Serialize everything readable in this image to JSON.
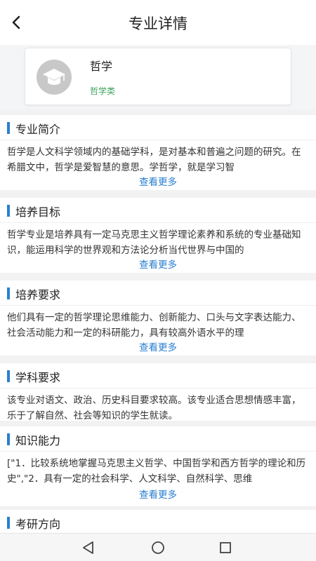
{
  "header": {
    "title": "专业详情",
    "back_icon": "chevron-left-icon"
  },
  "major": {
    "name": "哲学",
    "category": "哲学类",
    "icon": "graduation-cap-icon",
    "category_color": "#3aa35a"
  },
  "more_label": "查看更多",
  "sections": [
    {
      "title": "专业简介",
      "body": "哲学是人文科学领域内的基础学科，是对基本和普遍之问题的研究。在希腊文中，哲学是爱智慧的意思。学哲学，就是学习智"
    },
    {
      "title": "培养目标",
      "body": "哲学专业是培养具有一定马克思主义哲学理论素养和系统的专业基础知识，能运用科学的世界观和方法论分析当代世界与中国的"
    },
    {
      "title": "培养要求",
      "body": "他们具有一定的哲学理论思维能力、创新能力、口头与文字表达能力、社会活动能力和一定的科研能力，具有较高外语水平的理"
    },
    {
      "title": "学科要求",
      "body": "该专业对语文、政治、历史科目要求较高。该专业适合思想情感丰富，乐于了解自然、社会等知识的学生就读。"
    },
    {
      "title": "知识能力",
      "body": "[\"1．比较系统地掌握马克思主义哲学、中国哲学和西方哲学的理论和历史\",\"2．具有一定的社会科学、人文科学、自然科学、思维"
    },
    {
      "title": "考研方向"
    }
  ],
  "accent_color": "#2a7fd0",
  "navbar": {
    "back": "triangle-back-icon",
    "home": "circle-home-icon",
    "recents": "square-recents-icon"
  }
}
